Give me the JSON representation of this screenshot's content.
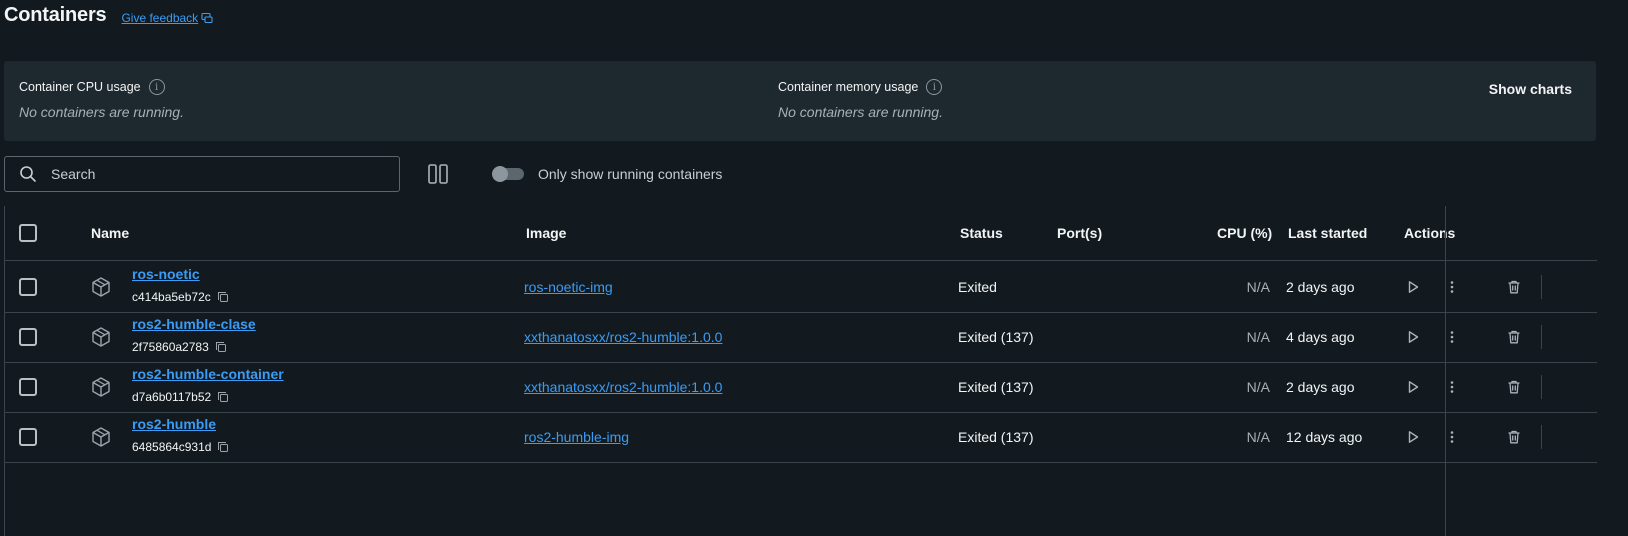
{
  "header": {
    "title": "Containers",
    "feedback_label": "Give feedback"
  },
  "usage": {
    "cpu_label": "Container CPU usage",
    "cpu_message": "No containers are running.",
    "memory_label": "Container memory usage",
    "memory_message": "No containers are running.",
    "show_charts_label": "Show charts"
  },
  "toolbar": {
    "search_placeholder": "Search",
    "toggle_label": "Only show running containers",
    "toggle_on": false
  },
  "table": {
    "columns": {
      "name": "Name",
      "image": "Image",
      "status": "Status",
      "ports": "Port(s)",
      "cpu": "CPU (%)",
      "last_started": "Last started",
      "actions": "Actions"
    },
    "rows": [
      {
        "name": "ros-noetic",
        "id": "c414ba5eb72c",
        "image": "ros-noetic-img",
        "status": "Exited",
        "ports": "",
        "cpu": "N/A",
        "last_started": "2 days ago"
      },
      {
        "name": "ros2-humble-clase",
        "id": "2f75860a2783",
        "image": "xxthanatosxx/ros2-humble:1.0.0",
        "status": "Exited (137)",
        "ports": "",
        "cpu": "N/A",
        "last_started": "4 days ago"
      },
      {
        "name": "ros2-humble-container",
        "id": "d7a6b0117b52",
        "image": "xxthanatosxx/ros2-humble:1.0.0",
        "status": "Exited (137)",
        "ports": "",
        "cpu": "N/A",
        "last_started": "2 days ago"
      },
      {
        "name": "ros2-humble",
        "id": "6485864c931d",
        "image": "ros2-humble-img",
        "status": "Exited (137)",
        "ports": "",
        "cpu": "N/A",
        "last_started": "12 days ago"
      }
    ]
  },
  "colors": {
    "background": "#131a1f",
    "panel": "#1e282f",
    "link": "#3a9cf4",
    "border": "#3a444b"
  }
}
